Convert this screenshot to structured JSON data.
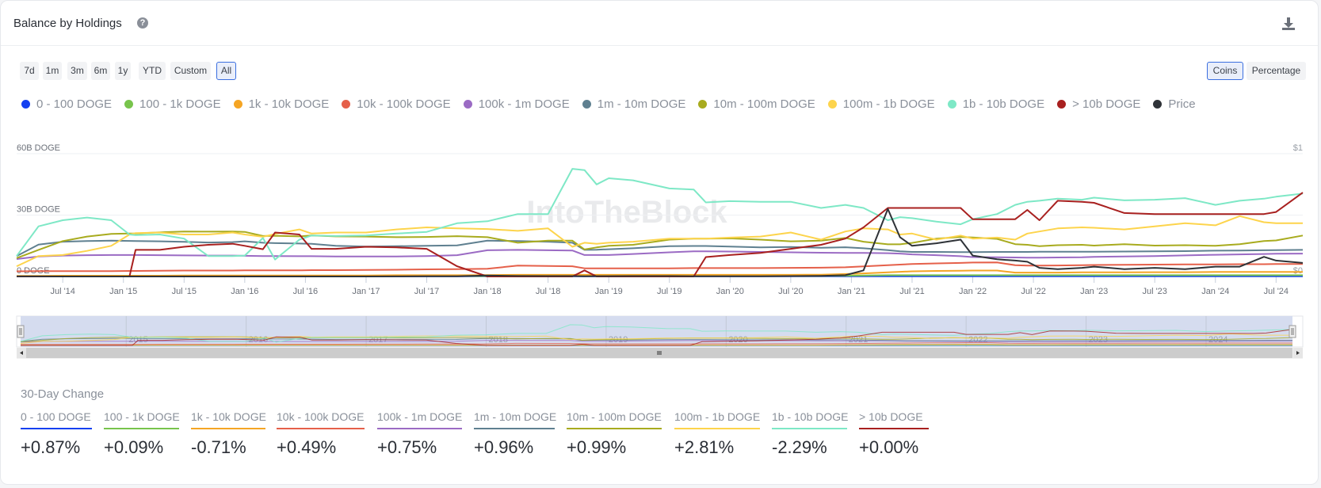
{
  "header": {
    "title": "Balance by Holdings",
    "help_icon": "?",
    "download_icon": "download-icon"
  },
  "ranges": [
    "7d",
    "1m",
    "3m",
    "6m",
    "1y",
    "YTD",
    "Custom",
    "All"
  ],
  "active_range": "All",
  "units": {
    "coins": "Coins",
    "percentage": "Percentage",
    "active": "Coins"
  },
  "watermark": "IntoTheBlock",
  "chart_data": {
    "type": "line",
    "title": "Balance by Holdings",
    "ylabel": "DOGE",
    "y_ticks": [
      "0 DOGE",
      "30B DOGE",
      "60B DOGE"
    ],
    "ylim": [
      0,
      60
    ],
    "y_unit": "B DOGE",
    "y2_ticks": [
      "$0",
      "$1"
    ],
    "y2lim": [
      0,
      1
    ],
    "x_ticks": [
      "Jul '14",
      "Jan '15",
      "Jul '15",
      "Jan '16",
      "Jul '16",
      "Jan '17",
      "Jul '17",
      "Jan '18",
      "Jul '18",
      "Jan '19",
      "Jul '19",
      "Jan '20",
      "Jul '20",
      "Jan '21",
      "Jul '21",
      "Jan '22",
      "Jul '22",
      "Jan '23",
      "Jul '23",
      "Jan '24",
      "Jul '24"
    ],
    "xlim": [
      2014.12,
      2024.72
    ],
    "legend_position": "top",
    "grid": true,
    "navigator_years": [
      "2015",
      "2016",
      "2017",
      "2018",
      "2019",
      "2020",
      "2021",
      "2022",
      "2023",
      "2024"
    ],
    "x": [
      2014.12,
      2014.3,
      2014.5,
      2014.7,
      2014.9,
      2015.05,
      2015.1,
      2015.3,
      2015.5,
      2015.7,
      2015.9,
      2016.0,
      2016.15,
      2016.25,
      2016.45,
      2016.55,
      2016.75,
      2017.0,
      2017.25,
      2017.5,
      2017.75,
      2018.0,
      2018.25,
      2018.5,
      2018.7,
      2018.8,
      2018.9,
      2019.0,
      2019.2,
      2019.5,
      2019.7,
      2019.8,
      2020.0,
      2020.25,
      2020.5,
      2020.75,
      2020.95,
      2021.1,
      2021.3,
      2021.4,
      2021.5,
      2021.7,
      2021.9,
      2022.0,
      2022.2,
      2022.35,
      2022.45,
      2022.55,
      2022.7,
      2022.9,
      2023.0,
      2023.25,
      2023.5,
      2023.75,
      2024.0,
      2024.2,
      2024.4,
      2024.5,
      2024.72
    ],
    "series": [
      {
        "name": "0 - 100 DOGE",
        "color": "#1440f0",
        "values": [
          0.1,
          0.1,
          0.1,
          0.1,
          0.1,
          0.1,
          0.1,
          0.1,
          0.1,
          0.1,
          0.1,
          0.1,
          0.1,
          0.1,
          0.1,
          0.1,
          0.1,
          0.1,
          0.1,
          0.1,
          0.1,
          0.1,
          0.1,
          0.1,
          0.1,
          0.1,
          0.1,
          0.1,
          0.1,
          0.1,
          0.1,
          0.1,
          0.1,
          0.1,
          0.1,
          0.1,
          0.1,
          0.1,
          0.1,
          0.1,
          0.1,
          0.1,
          0.1,
          0.1,
          0.1,
          0.1,
          0.1,
          0.1,
          0.1,
          0.1,
          0.1,
          0.1,
          0.1,
          0.1,
          0.1,
          0.1,
          0.1,
          0.1,
          0.1
        ]
      },
      {
        "name": "100 - 1k DOGE",
        "color": "#78c44c",
        "values": [
          0.2,
          0.2,
          0.2,
          0.2,
          0.2,
          0.2,
          0.2,
          0.2,
          0.2,
          0.2,
          0.2,
          0.2,
          0.2,
          0.2,
          0.2,
          0.2,
          0.2,
          0.2,
          0.2,
          0.2,
          0.2,
          0.2,
          0.2,
          0.2,
          0.2,
          0.2,
          0.2,
          0.2,
          0.2,
          0.2,
          0.2,
          0.2,
          0.2,
          0.2,
          0.2,
          0.3,
          0.4,
          0.5,
          0.6,
          0.6,
          0.6,
          0.6,
          0.6,
          0.6,
          0.6,
          0.6,
          0.6,
          0.6,
          0.6,
          0.6,
          0.6,
          0.6,
          0.6,
          0.6,
          0.6,
          0.6,
          0.6,
          0.6,
          0.6
        ]
      },
      {
        "name": "1k - 10k DOGE",
        "color": "#f5a524",
        "values": [
          0.3,
          0.3,
          0.4,
          0.4,
          0.4,
          0.4,
          0.4,
          0.4,
          0.5,
          0.5,
          0.5,
          0.5,
          0.5,
          0.5,
          0.5,
          0.5,
          0.5,
          0.5,
          0.6,
          0.6,
          0.6,
          0.7,
          0.8,
          0.8,
          0.8,
          0.8,
          0.8,
          0.8,
          0.8,
          0.8,
          0.8,
          0.8,
          0.8,
          0.8,
          0.8,
          0.9,
          1.2,
          1.5,
          2.0,
          2.3,
          2.5,
          2.7,
          2.8,
          2.9,
          2.9,
          1.9,
          1.9,
          1.9,
          1.9,
          2.0,
          2.0,
          2.0,
          2.1,
          2.1,
          2.2,
          2.2,
          2.2,
          2.2,
          2.2
        ]
      },
      {
        "name": "10k - 100k DOGE",
        "color": "#e5604a",
        "values": [
          2.5,
          2.6,
          2.6,
          2.6,
          2.6,
          2.7,
          2.7,
          2.8,
          2.9,
          2.9,
          2.9,
          3.0,
          3.0,
          3.0,
          3.0,
          3.1,
          3.1,
          3.2,
          3.3,
          3.5,
          3.6,
          3.8,
          5.3,
          5.1,
          5.0,
          4.0,
          4.0,
          4.0,
          4.0,
          4.0,
          4.1,
          4.1,
          4.1,
          4.1,
          4.2,
          4.3,
          4.5,
          4.9,
          5.5,
          5.8,
          6.1,
          6.4,
          6.6,
          6.8,
          6.9,
          5.5,
          5.3,
          5.3,
          5.4,
          5.5,
          5.6,
          5.7,
          5.8,
          5.9,
          5.9,
          6.0,
          6.0,
          6.1,
          6.1
        ]
      },
      {
        "name": "100k - 1m DOGE",
        "color": "#9b6bc4",
        "values": [
          8.5,
          9.8,
          10.2,
          10.4,
          10.5,
          10.5,
          10.5,
          10.4,
          10.3,
          10.2,
          10.2,
          10.1,
          10.0,
          10.0,
          9.9,
          9.9,
          9.8,
          9.8,
          9.8,
          10.0,
          10.4,
          12.8,
          13.0,
          12.8,
          12.7,
          10.5,
          10.5,
          10.5,
          11.0,
          11.8,
          12.3,
          12.3,
          12.2,
          12.0,
          11.8,
          11.6,
          11.5,
          11.5,
          11.4,
          11.2,
          10.8,
          10.4,
          9.9,
          9.5,
          9.4,
          9.3,
          9.2,
          9.2,
          9.3,
          9.4,
          9.6,
          9.8,
          10.0,
          10.3,
          10.6,
          10.8,
          11.0,
          11.1,
          11.2
        ]
      },
      {
        "name": "1m - 10m DOGE",
        "color": "#5f8090",
        "values": [
          10.0,
          15.6,
          17.0,
          17.3,
          17.5,
          17.4,
          17.3,
          17.2,
          16.9,
          16.6,
          16.8,
          17.2,
          16.5,
          16.3,
          16.1,
          16.0,
          15.0,
          14.6,
          14.8,
          15.0,
          15.2,
          17.5,
          17.3,
          17.0,
          16.5,
          13.0,
          13.1,
          13.3,
          13.8,
          14.8,
          14.9,
          14.9,
          14.6,
          14.2,
          14.4,
          14.0,
          14.3,
          13.8,
          12.9,
          12.3,
          12.0,
          12.0,
          11.9,
          11.9,
          12.0,
          12.0,
          12.0,
          12.1,
          12.1,
          12.1,
          12.1,
          12.2,
          12.3,
          12.4,
          12.6,
          12.7,
          12.8,
          12.9,
          13.0
        ]
      },
      {
        "name": "10m - 100m DOGE",
        "color": "#a8ab1e",
        "values": [
          9.0,
          13.0,
          17.3,
          19.5,
          20.8,
          21.0,
          21.0,
          21.6,
          22.0,
          21.9,
          22.0,
          21.8,
          19.8,
          19.9,
          19.6,
          20.0,
          19.6,
          19.5,
          19.2,
          19.3,
          19.7,
          19.2,
          16.5,
          17.5,
          17.5,
          13.2,
          14.2,
          15.0,
          15.5,
          18.0,
          18.5,
          18.5,
          18.6,
          18.0,
          17.2,
          17.5,
          18.8,
          17.0,
          15.7,
          15.7,
          16.4,
          18.5,
          19.3,
          19.1,
          18.4,
          15.8,
          15.5,
          14.8,
          15.3,
          15.5,
          15.1,
          15.8,
          15.1,
          15.3,
          15.0,
          15.8,
          17.3,
          17.6,
          20.0
        ]
      },
      {
        "name": "100m - 1b DOGE",
        "color": "#fdd44c",
        "values": [
          5.0,
          10.0,
          10.5,
          12.5,
          15.0,
          20.5,
          21.2,
          21.5,
          20.5,
          20.5,
          21.5,
          20.5,
          19.4,
          20.8,
          23.0,
          21.0,
          21.5,
          21.5,
          23.0,
          24.0,
          23.5,
          23.2,
          22.3,
          23.5,
          14.5,
          16.5,
          16.0,
          16.5,
          17.0,
          18.5,
          18.5,
          18.5,
          19.0,
          19.5,
          21.5,
          18.0,
          22.0,
          23.5,
          23.0,
          20.5,
          21.0,
          18.0,
          20.0,
          18.5,
          19.0,
          18.0,
          21.0,
          22.0,
          23.5,
          24.0,
          23.8,
          23.0,
          24.5,
          26.0,
          25.0,
          29.5,
          26.5,
          26.0,
          26.0
        ]
      },
      {
        "name": "1b - 10b DOGE",
        "color": "#7ee8c6",
        "values": [
          10.0,
          24.5,
          27.5,
          28.8,
          27.5,
          20.5,
          20.2,
          20.5,
          18.5,
          10.0,
          10.0,
          10.2,
          18.8,
          8.3,
          18.0,
          20.0,
          19.8,
          20.0,
          21.0,
          21.8,
          26.0,
          27.0,
          30.5,
          30.5,
          52.6,
          52.0,
          45.0,
          48.0,
          47.0,
          43.0,
          42.5,
          36.2,
          36.8,
          36.5,
          36.5,
          33.5,
          35.0,
          33.5,
          27.5,
          29.0,
          28.5,
          26.8,
          25.5,
          28.0,
          30.5,
          35.0,
          36.5,
          37.0,
          38.0,
          37.5,
          38.5,
          37.2,
          37.5,
          38.3,
          35.0,
          37.0,
          38.0,
          39.0,
          40.5
        ]
      },
      {
        "name": "> 10b DOGE",
        "color": "#a8201f",
        "values": [
          0,
          0,
          0,
          0,
          0,
          0,
          13.0,
          13.0,
          14.5,
          15.5,
          16.0,
          15.0,
          13.3,
          21.5,
          20.5,
          13.5,
          13.5,
          14.5,
          14.2,
          13.5,
          5.0,
          0,
          0,
          0,
          0,
          3.0,
          0,
          0,
          0,
          0,
          0,
          9.5,
          10.5,
          11.5,
          13.5,
          15.5,
          18.5,
          24.0,
          33.5,
          33.5,
          33.5,
          33.5,
          33.5,
          28.0,
          28.0,
          28.0,
          32.5,
          27.5,
          37.0,
          36.5,
          36.0,
          31.0,
          30.5,
          30.5,
          30.5,
          30.5,
          30.5,
          31.5,
          41.0
        ]
      },
      {
        "name": "Price",
        "color": "#2f3338",
        "axis": "y2",
        "values": [
          0.0005,
          0.0005,
          0.0003,
          0.0002,
          0.0002,
          0.0002,
          0.0002,
          0.0002,
          0.0002,
          0.0002,
          0.0002,
          0.0002,
          0.0002,
          0.0002,
          0.0003,
          0.0003,
          0.0003,
          0.0003,
          0.0006,
          0.0019,
          0.001,
          0.008,
          0.0036,
          0.003,
          0.003,
          0.002,
          0.0025,
          0.0025,
          0.003,
          0.003,
          0.002,
          0.002,
          0.002,
          0.002,
          0.0033,
          0.005,
          0.01,
          0.05,
          0.55,
          0.32,
          0.25,
          0.27,
          0.3,
          0.17,
          0.14,
          0.13,
          0.12,
          0.07,
          0.06,
          0.07,
          0.08,
          0.06,
          0.07,
          0.06,
          0.08,
          0.08,
          0.16,
          0.13,
          0.11
        ]
      }
    ]
  },
  "thirty_day_change": {
    "title": "30-Day Change",
    "items": [
      {
        "label": "0 - 100 DOGE",
        "value": "+0.87%",
        "color": "#1440f0"
      },
      {
        "label": "100 - 1k DOGE",
        "value": "+0.09%",
        "color": "#78c44c"
      },
      {
        "label": "1k - 10k DOGE",
        "value": "-0.71%",
        "color": "#f5a524"
      },
      {
        "label": "10k - 100k DOGE",
        "value": "+0.49%",
        "color": "#e5604a"
      },
      {
        "label": "100k - 1m DOGE",
        "value": "+0.75%",
        "color": "#9b6bc4"
      },
      {
        "label": "1m - 10m DOGE",
        "value": "+0.96%",
        "color": "#5f8090"
      },
      {
        "label": "10m - 100m DOGE",
        "value": "+0.99%",
        "color": "#a8ab1e"
      },
      {
        "label": "100m - 1b DOGE",
        "value": "+2.81%",
        "color": "#fdd44c"
      },
      {
        "label": "1b - 10b DOGE",
        "value": "-2.29%",
        "color": "#7ee8c6"
      },
      {
        "label": "> 10b DOGE",
        "value": "+0.00%",
        "color": "#a8201f"
      }
    ]
  }
}
